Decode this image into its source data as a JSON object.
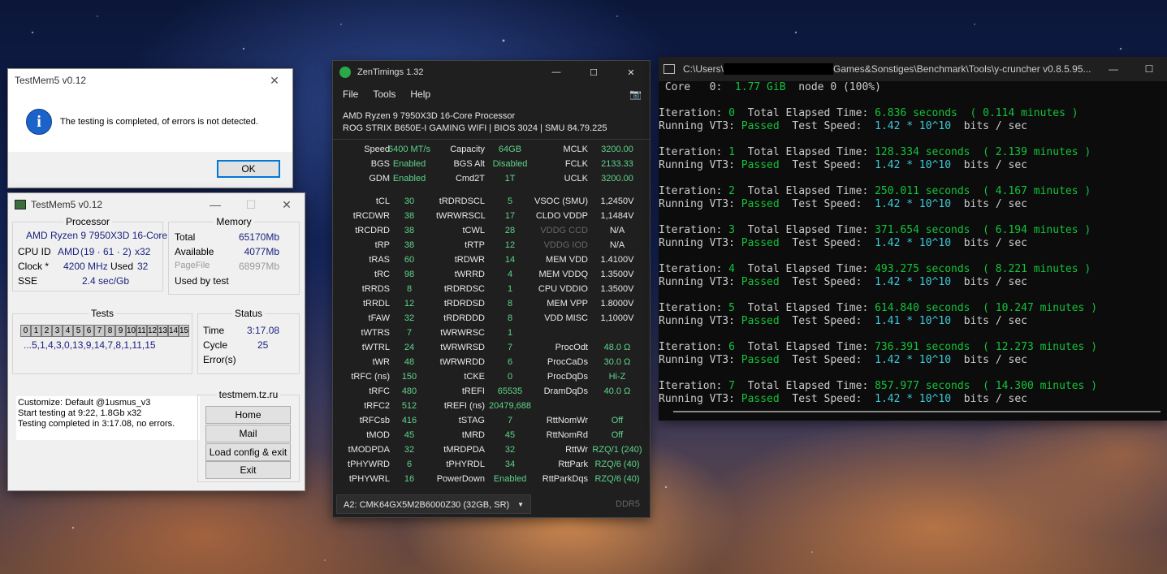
{
  "msgbox": {
    "title": "TestMem5 v0.12",
    "message": "The testing is completed, of errors is not detected.",
    "ok": "OK"
  },
  "testmem": {
    "title": "TestMem5 v0.12",
    "processor": {
      "label": "Processor",
      "name": "AMD Ryzen 9 7950X3D 16-Core",
      "cpu_id_label": "CPU ID",
      "cpu_id_vendor": "AMD",
      "cpu_id_value": "(19 · 61 · 2)",
      "cpu_threads": "x32",
      "clock_label": "Clock *",
      "clock_value": "4200 MHz",
      "used_label": "Used",
      "used_value": "32",
      "sse_label": "SSE",
      "sse_value": "2.4 sec/Gb"
    },
    "memory": {
      "label": "Memory",
      "total_label": "Total",
      "total_value": "65170Mb",
      "available_label": "Available",
      "available_value": "4077Mb",
      "pagefile_label": "PageFile",
      "pagefile_value": "68997Mb",
      "usedbytest_label": "Used by test"
    },
    "tests": {
      "label": "Tests",
      "cells": [
        "0",
        "1",
        "2",
        "3",
        "4",
        "5",
        "6",
        "7",
        "8",
        "9",
        "10",
        "11",
        "12",
        "13",
        "14",
        "15"
      ],
      "sequence": "...5,1,4,3,0,13,9,14,7,8,1,11,15"
    },
    "status": {
      "label": "Status",
      "time_label": "Time",
      "time_value": "3:17.08",
      "cycle_label": "Cycle",
      "cycle_value": "25",
      "errors_label": "Error(s)"
    },
    "log": {
      "line1": "Customize: Default @1usmus_v3",
      "line2": "Start testing at 9:22, 1.8Gb x32",
      "line3": "Testing completed in 3:17.08, no errors."
    },
    "site": {
      "label": "testmem.tz.ru",
      "home": "Home",
      "mail": "Mail",
      "load": "Load config & exit",
      "exit": "Exit"
    }
  },
  "zen": {
    "title": "ZenTimings 1.32",
    "menu": [
      "File",
      "Tools",
      "Help"
    ],
    "cpu": "AMD Ryzen 9 7950X3D 16-Core Processor",
    "board": "ROG STRIX B650E-I GAMING WIFI | BIOS 3024 | SMU 84.79.225",
    "top": [
      [
        "Speed",
        "6400 MT/s",
        "Capacity",
        "64GB",
        "MCLK",
        "3200.00"
      ],
      [
        "BGS",
        "Enabled",
        "BGS Alt",
        "Disabled",
        "FCLK",
        "2133.33"
      ],
      [
        "GDM",
        "Enabled",
        "Cmd2T",
        "1T",
        "UCLK",
        "3200.00"
      ]
    ],
    "rows": [
      [
        "tCL",
        "30",
        "tRDRDSCL",
        "5",
        "VSOC (SMU)",
        "1,2450V"
      ],
      [
        "tRCDWR",
        "38",
        "tWRWRSCL",
        "17",
        "CLDO VDDP",
        "1,1484V"
      ],
      [
        "tRCDRD",
        "38",
        "tCWL",
        "28",
        "VDDG CCD",
        "N/A"
      ],
      [
        "tRP",
        "38",
        "tRTP",
        "12",
        "VDDG IOD",
        "N/A"
      ],
      [
        "tRAS",
        "60",
        "tRDWR",
        "14",
        "MEM VDD",
        "1.4100V"
      ],
      [
        "tRC",
        "98",
        "tWRRD",
        "4",
        "MEM VDDQ",
        "1.3500V"
      ],
      [
        "tRRDS",
        "8",
        "tRDRDSC",
        "1",
        "CPU VDDIO",
        "1.3500V"
      ],
      [
        "tRRDL",
        "12",
        "tRDRDSD",
        "8",
        "MEM VPP",
        "1.8000V"
      ],
      [
        "tFAW",
        "32",
        "tRDRDDD",
        "8",
        "VDD MISC",
        "1,1000V"
      ],
      [
        "tWTRS",
        "7",
        "tWRWRSC",
        "1",
        "",
        ""
      ],
      [
        "tWTRL",
        "24",
        "tWRWRSD",
        "7",
        "ProcOdt",
        "48.0 Ω"
      ],
      [
        "tWR",
        "48",
        "tWRWRDD",
        "6",
        "ProcCaDs",
        "30.0 Ω"
      ],
      [
        "tRFC (ns)",
        "150",
        "tCKE",
        "0",
        "ProcDqDs",
        "Hi-Z"
      ],
      [
        "tRFC",
        "480",
        "tREFI",
        "65535",
        "DramDqDs",
        "40.0 Ω"
      ],
      [
        "tRFC2",
        "512",
        "tREFI (ns)",
        "20479,688",
        "",
        ""
      ],
      [
        "tRFCsb",
        "416",
        "tSTAG",
        "7",
        "RttNomWr",
        "Off"
      ],
      [
        "tMOD",
        "45",
        "tMRD",
        "45",
        "RttNomRd",
        "Off"
      ],
      [
        "tMODPDA",
        "32",
        "tMRDPDA",
        "32",
        "RttWr",
        "RZQ/1 (240)"
      ],
      [
        "tPHYWRD",
        "6",
        "tPHYRDL",
        "34",
        "RttPark",
        "RZQ/6 (40)"
      ],
      [
        "tPHYWRL",
        "16",
        "PowerDown",
        "Enabled",
        "RttParkDqs",
        "RZQ/6 (40)"
      ]
    ],
    "module": "A2: CMK64GX5M2B6000Z30 (32GB, SR)",
    "ddr": "DDR5"
  },
  "terminal": {
    "title_prefix": "C:\\Users\\",
    "title_suffix": "Games&Sonstiges\\Benchmark\\Tools\\y-cruncher v0.8.5.95...",
    "core_line": {
      "a": " Core   0:  ",
      "b": "1.77 GiB",
      "c": "  node 0 (100%)"
    },
    "iterations": [
      {
        "n": "0",
        "elapsed": "6.836 seconds",
        "minutes": "( 0.114 minutes )",
        "speed": "1.42 * 10^10"
      },
      {
        "n": "1",
        "elapsed": "128.334 seconds",
        "minutes": "( 2.139 minutes )",
        "speed": "1.42 * 10^10"
      },
      {
        "n": "2",
        "elapsed": "250.011 seconds",
        "minutes": "( 4.167 minutes )",
        "speed": "1.42 * 10^10"
      },
      {
        "n": "3",
        "elapsed": "371.654 seconds",
        "minutes": "( 6.194 minutes )",
        "speed": "1.42 * 10^10"
      },
      {
        "n": "4",
        "elapsed": "493.275 seconds",
        "minutes": "( 8.221 minutes )",
        "speed": "1.42 * 10^10"
      },
      {
        "n": "5",
        "elapsed": "614.840 seconds",
        "minutes": "( 10.247 minutes )",
        "speed": "1.41 * 10^10"
      },
      {
        "n": "6",
        "elapsed": "736.391 seconds",
        "minutes": "( 12.273 minutes )",
        "speed": "1.42 * 10^10"
      },
      {
        "n": "7",
        "elapsed": "857.977 seconds",
        "minutes": "( 14.300 minutes )",
        "speed": "1.42 * 10^10"
      }
    ],
    "iteration_label": "Iteration: ",
    "total_label": "  Total Elapsed Time: ",
    "running_label": "Running VT3: ",
    "passed": "Passed",
    "speed_label": "  Test Speed:  ",
    "unit": "  bits / sec"
  }
}
